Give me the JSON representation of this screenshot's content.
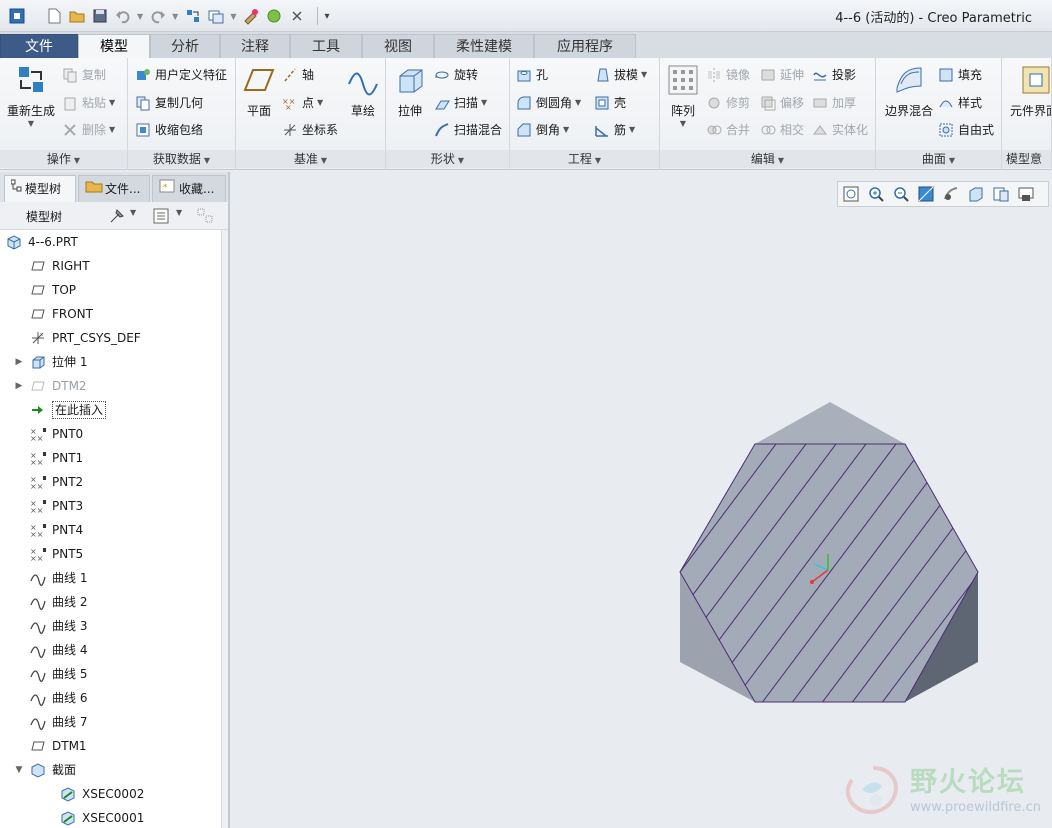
{
  "window": {
    "title": "4--6 (活动的) - Creo Parametric"
  },
  "tabs": [
    {
      "label": "文件"
    },
    {
      "label": "模型"
    },
    {
      "label": "分析"
    },
    {
      "label": "注释"
    },
    {
      "label": "工具"
    },
    {
      "label": "视图"
    },
    {
      "label": "柔性建模"
    },
    {
      "label": "应用程序"
    }
  ],
  "ribbon": {
    "operations": {
      "label": "操作",
      "regenerate": "重新生成",
      "copy": "复制",
      "paste": "粘贴",
      "delete": "删除"
    },
    "get_data": {
      "label": "获取数据",
      "udf": "用户定义特征",
      "copy_geometry": "复制几何",
      "shrinkwrap": "收缩包络"
    },
    "datum": {
      "label": "基准",
      "plane": "平面",
      "axis": "轴",
      "point": "点",
      "csys": "坐标系",
      "sketch": "草绘"
    },
    "shapes": {
      "label": "形状",
      "extrude": "拉伸",
      "revolve": "旋转",
      "sweep": "扫描",
      "swept_blend": "扫描混合"
    },
    "engineering": {
      "label": "工程",
      "hole": "孔",
      "round": "倒圆角",
      "chamfer": "倒角",
      "draft": "拔模",
      "shell": "壳",
      "rib": "筋"
    },
    "editing": {
      "label": "编辑",
      "pattern": "阵列",
      "mirror": "镜像",
      "extend": "延伸",
      "project": "投影",
      "trim": "修剪",
      "offset": "偏移",
      "thicken": "加厚",
      "merge": "合并",
      "intersect": "相交",
      "solidify": "实体化"
    },
    "surfaces": {
      "label": "曲面",
      "boundary_blend": "边界混合",
      "fill": "填充",
      "style": "样式",
      "freestyle": "自由式"
    },
    "model_intent": {
      "label": "模型意图",
      "component_interface": "元件界面"
    }
  },
  "navigator": {
    "tabs": [
      {
        "label": "模型树"
      },
      {
        "label": "文件..."
      },
      {
        "label": "收藏..."
      }
    ],
    "tree_header": "模型树"
  },
  "tree": [
    {
      "label": "4--6.PRT",
      "icon": "part-icon",
      "indent": 0,
      "exp": ""
    },
    {
      "label": "RIGHT",
      "icon": "datum-plane-icon",
      "indent": 1,
      "exp": ""
    },
    {
      "label": "TOP",
      "icon": "datum-plane-icon",
      "indent": 1,
      "exp": ""
    },
    {
      "label": "FRONT",
      "icon": "datum-plane-icon",
      "indent": 1,
      "exp": ""
    },
    {
      "label": "PRT_CSYS_DEF",
      "icon": "csys-icon",
      "indent": 1,
      "exp": ""
    },
    {
      "label": "拉伸 1",
      "icon": "extrude-icon",
      "indent": 1,
      "exp": "▶"
    },
    {
      "label": "DTM2",
      "icon": "datum-plane-icon",
      "indent": 1,
      "exp": "▶",
      "dim": true
    },
    {
      "label": "在此插入",
      "icon": "insert-arrow-icon",
      "indent": 1,
      "exp": "",
      "boxed": true
    },
    {
      "label": "PNT0",
      "icon": "datum-point-icon",
      "indent": 1,
      "exp": ""
    },
    {
      "label": "PNT1",
      "icon": "datum-point-icon",
      "indent": 1,
      "exp": ""
    },
    {
      "label": "PNT2",
      "icon": "datum-point-icon",
      "indent": 1,
      "exp": ""
    },
    {
      "label": "PNT3",
      "icon": "datum-point-icon",
      "indent": 1,
      "exp": ""
    },
    {
      "label": "PNT4",
      "icon": "datum-point-icon",
      "indent": 1,
      "exp": ""
    },
    {
      "label": "PNT5",
      "icon": "datum-point-icon",
      "indent": 1,
      "exp": ""
    },
    {
      "label": "曲线 1",
      "icon": "curve-icon",
      "indent": 1,
      "exp": ""
    },
    {
      "label": "曲线 2",
      "icon": "curve-icon",
      "indent": 1,
      "exp": ""
    },
    {
      "label": "曲线 3",
      "icon": "curve-icon",
      "indent": 1,
      "exp": ""
    },
    {
      "label": "曲线 4",
      "icon": "curve-icon",
      "indent": 1,
      "exp": ""
    },
    {
      "label": "曲线 5",
      "icon": "curve-icon",
      "indent": 1,
      "exp": ""
    },
    {
      "label": "曲线 6",
      "icon": "curve-icon",
      "indent": 1,
      "exp": ""
    },
    {
      "label": "曲线 7",
      "icon": "curve-icon",
      "indent": 1,
      "exp": ""
    },
    {
      "label": "DTM1",
      "icon": "datum-plane-icon",
      "indent": 1,
      "exp": ""
    },
    {
      "label": "截面",
      "icon": "section-folder-icon",
      "indent": 1,
      "exp": "▼"
    },
    {
      "label": "XSEC0002",
      "icon": "xsection-icon",
      "indent": 2,
      "exp": ""
    },
    {
      "label": "XSEC0001",
      "icon": "xsection-icon",
      "indent": 2,
      "exp": ""
    }
  ],
  "watermark": {
    "title": "野火论坛",
    "url": "www.proewildfire.cn"
  },
  "colors": {
    "file_tab": "#3c5b86",
    "model_face": "#a4abb8",
    "model_side": "#8c94a1",
    "model_dark": "#5f6673",
    "hatch": "#4b2d74"
  }
}
